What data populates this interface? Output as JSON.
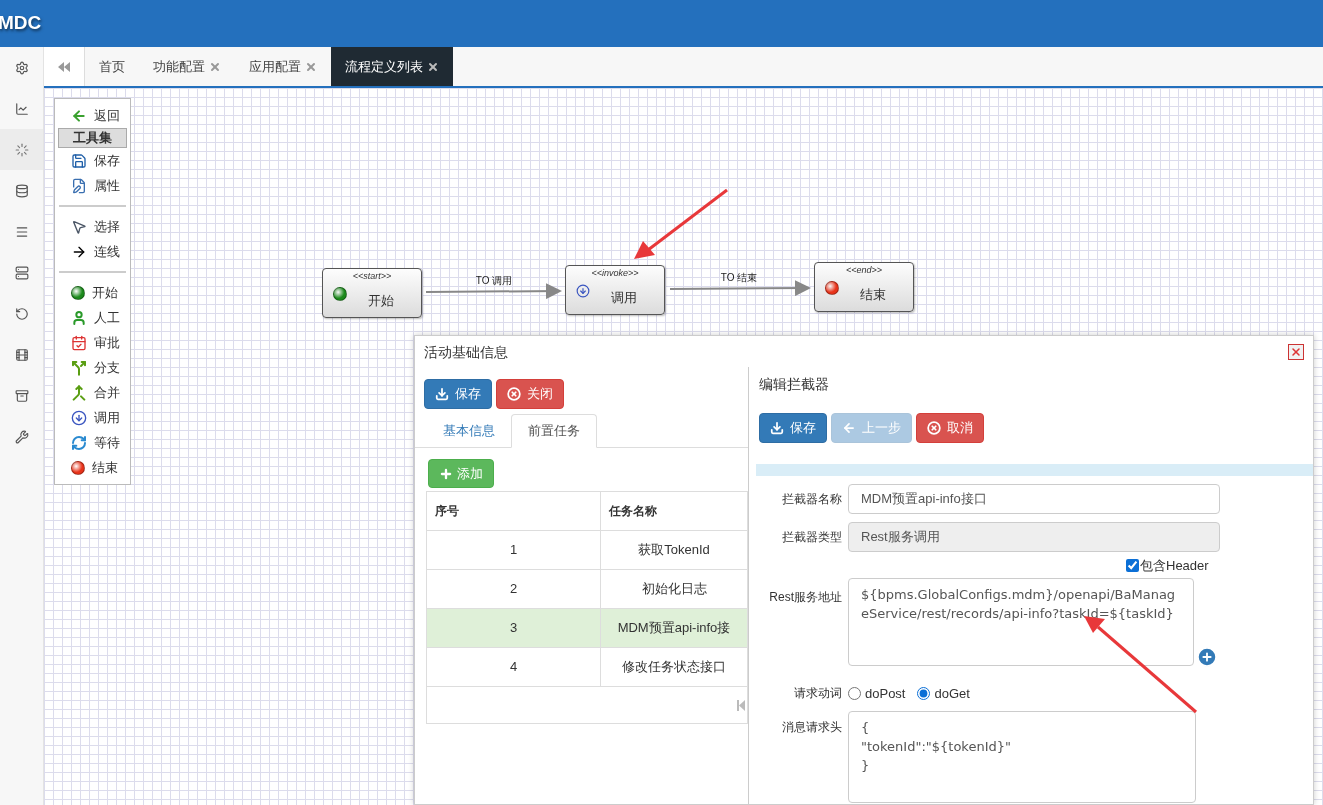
{
  "app": {
    "logo": "MDC"
  },
  "rail": [
    {
      "kind": "settings",
      "selected": false
    },
    {
      "kind": "chart",
      "selected": false
    },
    {
      "kind": "loader",
      "selected": true
    },
    {
      "kind": "database",
      "selected": false
    },
    {
      "kind": "menu",
      "selected": false
    },
    {
      "kind": "server",
      "selected": false
    },
    {
      "kind": "history",
      "selected": false
    },
    {
      "kind": "film",
      "selected": false
    },
    {
      "kind": "archive",
      "selected": false
    },
    {
      "kind": "wrench",
      "selected": false
    }
  ],
  "tabs": [
    {
      "label": "首页",
      "closable": false,
      "selected": false
    },
    {
      "label": "功能配置",
      "closable": true,
      "selected": false
    },
    {
      "label": "应用配置",
      "closable": true,
      "selected": false
    },
    {
      "label": "流程定义列表",
      "closable": true,
      "selected": true
    }
  ],
  "toolbox": [
    {
      "kind": "back",
      "label": "返回"
    },
    {
      "kind": "header",
      "label": "工具集"
    },
    {
      "kind": "save",
      "label": "保存"
    },
    {
      "kind": "properties",
      "label": "属性"
    },
    {
      "kind": "divider"
    },
    {
      "kind": "select",
      "label": "选择"
    },
    {
      "kind": "connect",
      "label": "连线"
    },
    {
      "kind": "divider"
    },
    {
      "kind": "start",
      "label": "开始"
    },
    {
      "kind": "human",
      "label": "人工"
    },
    {
      "kind": "approve",
      "label": "审批"
    },
    {
      "kind": "branch",
      "label": "分支"
    },
    {
      "kind": "merge",
      "label": "合并"
    },
    {
      "kind": "invoke",
      "label": "调用"
    },
    {
      "kind": "wait",
      "label": "等待"
    },
    {
      "kind": "end",
      "label": "结束"
    }
  ],
  "diagram": {
    "nodes": [
      {
        "kind": "start",
        "stereotype": "<<start>>",
        "label": "开始"
      },
      {
        "kind": "invoke",
        "stereotype": "<<invoke>>",
        "label": "调用"
      },
      {
        "kind": "end",
        "stereotype": "<<end>>",
        "label": "结束"
      }
    ],
    "edges": [
      {
        "label": "TO 调用"
      },
      {
        "label": "TO 结束"
      }
    ]
  },
  "dialog": {
    "title": "活动基础信息",
    "buttons": [
      {
        "kind": "save",
        "label": "保存"
      },
      {
        "kind": "close",
        "label": "关闭"
      }
    ],
    "tabs": [
      {
        "label": "基本信息",
        "selected": false
      },
      {
        "label": "前置任务",
        "selected": true
      }
    ],
    "add_button": "添加",
    "table": {
      "columns": [
        "序号",
        "任务名称"
      ],
      "rows": [
        {
          "cells": [
            "1",
            "获取TokenId"
          ],
          "selected": false
        },
        {
          "cells": [
            "2",
            "初始化日志"
          ],
          "selected": false
        },
        {
          "cells": [
            "3",
            "MDM预置api-info接"
          ],
          "selected": true
        },
        {
          "cells": [
            "4",
            "修改任务状态接口"
          ],
          "selected": false
        }
      ]
    },
    "editor": {
      "title": "编辑拦截器",
      "buttons": [
        {
          "kind": "save",
          "label": "保存",
          "disabled": false
        },
        {
          "kind": "back",
          "label": "上一步",
          "disabled": true
        },
        {
          "kind": "cancel",
          "label": "取消",
          "disabled": false
        }
      ],
      "name": {
        "label": "拦截器名称",
        "value": "MDM预置api-info接口",
        "disabled": false
      },
      "type": {
        "label": "拦截器类型",
        "value": "Rest服务调用",
        "disabled": true
      },
      "include_header": {
        "label": "包含Header",
        "checked": true
      },
      "url": {
        "label": "Rest服务地址",
        "value": "${bpms.GlobalConfigs.mdm}/openapi/BaManageService/rest/records/api-info?taskId=${taskId}"
      },
      "method": {
        "label": "请求动词",
        "options": [
          {
            "label": "doPost",
            "selected": false
          },
          {
            "label": "doGet",
            "selected": true
          }
        ]
      },
      "headers": {
        "label": "消息请求头",
        "value": "{\n\"tokenId\":\"${tokenId}\"\n}"
      }
    }
  }
}
